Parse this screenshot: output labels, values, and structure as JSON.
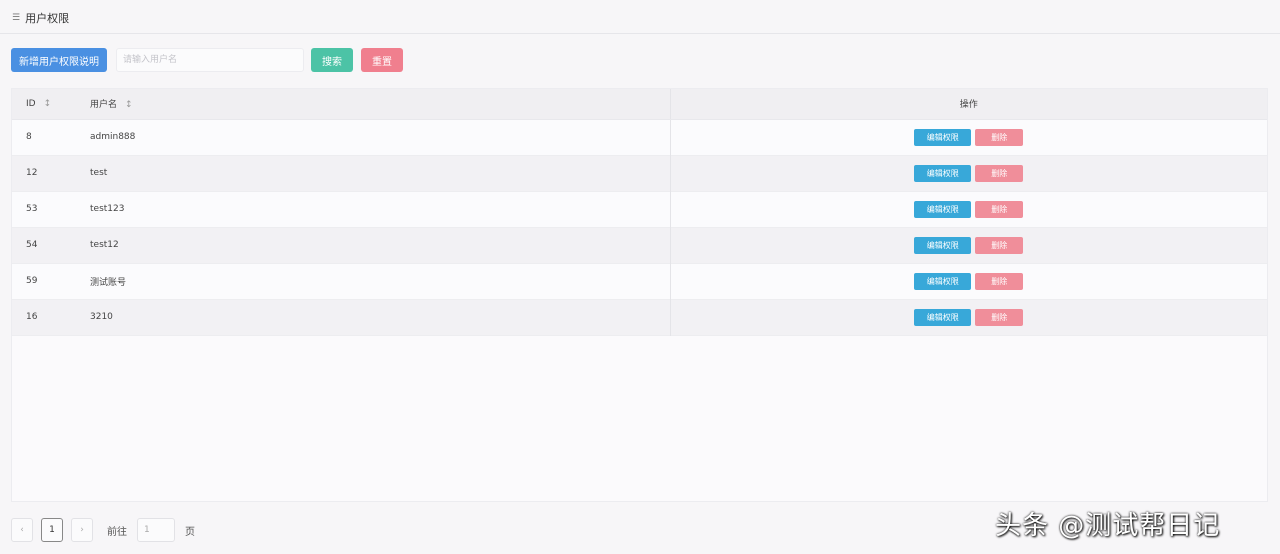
{
  "header": {
    "title": "用户权限",
    "icon": "list-icon"
  },
  "toolbar": {
    "add_label": "新增用户权限说明",
    "search_placeholder": "请输入用户名",
    "search_label": "搜索",
    "reset_label": "重置"
  },
  "table": {
    "columns": {
      "id": "ID",
      "name": "用户名",
      "ops": "操作"
    },
    "rows": [
      {
        "id": "8",
        "name": "admin888"
      },
      {
        "id": "12",
        "name": "test"
      },
      {
        "id": "53",
        "name": "test123"
      },
      {
        "id": "54",
        "name": "test12"
      },
      {
        "id": "59",
        "name": "测试账号"
      },
      {
        "id": "16",
        "name": "3210"
      }
    ],
    "edit_label": "编辑权限",
    "delete_label": "删除"
  },
  "pagination": {
    "prev": "‹",
    "current": "1",
    "next": "›",
    "goto_label": "前往",
    "jump_value": "1",
    "page_unit": "页"
  },
  "colors": {
    "primary": "#4a90e2",
    "search": "#4cc3a6",
    "reset": "#f07f8e",
    "edit": "#38a8d9",
    "delete": "#f08e9a"
  },
  "watermark": "头条 @测试帮日记"
}
